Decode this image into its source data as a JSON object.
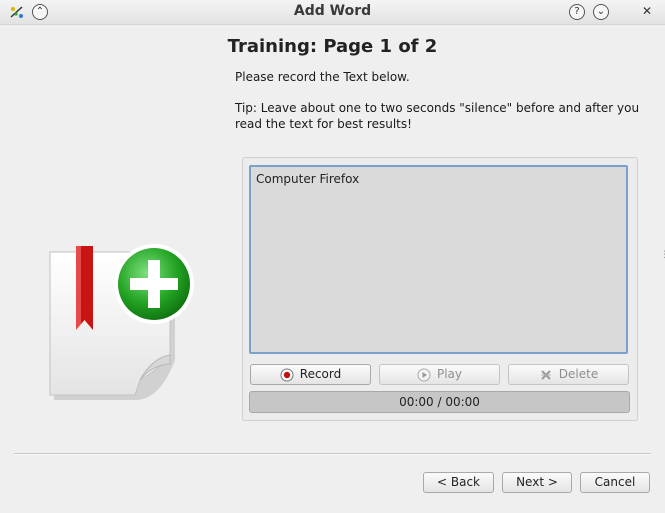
{
  "window": {
    "title": "Add Word",
    "help_symbol": "?",
    "menu_symbol": "⌄",
    "close_symbol": "✕",
    "keep_above_symbol": "⌃"
  },
  "page": {
    "title": "Training: Page 1 of 2",
    "instruction": "Please record the Text below.",
    "tip": "Tip: Leave about one to two seconds \"silence\" before and after you read the text for best results!"
  },
  "prompt": {
    "text": "Computer Firefox"
  },
  "recorder": {
    "record_label": "Record",
    "play_label": "Play",
    "delete_label": "Delete",
    "time": "00:00 / 00:00"
  },
  "navigation": {
    "back_label": "< Back",
    "next_label": "Next >",
    "cancel_label": "Cancel"
  },
  "icons": {
    "illustration": "bookmark-add-icon",
    "app": "app-icon",
    "record": "record-icon",
    "play": "play-icon",
    "delete": "delete-icon"
  },
  "colors": {
    "accent": "#7aa0cc",
    "record_red": "#c01010",
    "plus_green": "#22a322"
  }
}
